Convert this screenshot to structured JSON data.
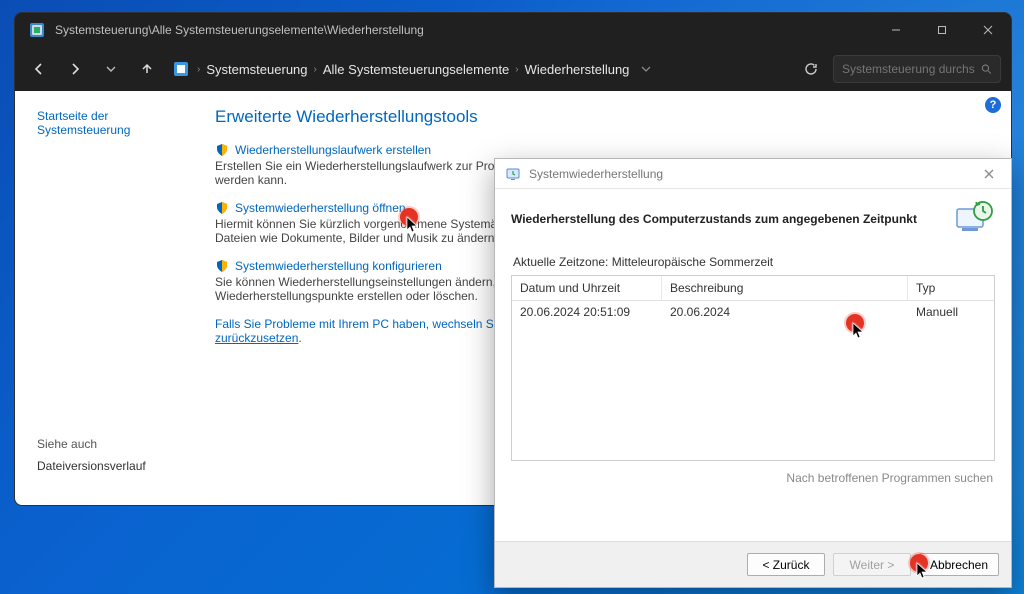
{
  "window": {
    "title": "Systemsteuerung\\Alle Systemsteuerungselemente\\Wiederherstellung"
  },
  "breadcrumb": {
    "root": "Systemsteuerung",
    "mid": "Alle Systemsteuerungselemente",
    "leaf": "Wiederherstellung"
  },
  "search": {
    "placeholder": "Systemsteuerung durchs…"
  },
  "sidebar": {
    "home": "Startseite der Systemsteuerung",
    "see_also_header": "Siehe auch",
    "file_history": "Dateiversionsverlauf"
  },
  "main": {
    "heading": "Erweiterte Wiederherstellungstools",
    "tool1_link": "Wiederherstellungslaufwerk erstellen",
    "tool1_desc": "Erstellen Sie ein Wiederherstellungslaufwerk zur Problembehandlung, wenn Ihr PC nicht gestartet werden kann.",
    "tool2_link": "Systemwiederherstellung öffnen",
    "tool2_desc": "Hiermit können Sie kürzlich vorgenommene Systemänderungen rückgängig machen, ohne jedoch Dateien wie Dokumente, Bilder und Musik zu ändern.",
    "tool3_link": "Systemwiederherstellung konfigurieren",
    "tool3_desc": "Sie können Wiederherstellungseinstellungen ändern, Speicherplatz verwalten und Wiederherstellungspunkte erstellen oder löschen.",
    "troubleshoot_a": "Falls Sie Probleme mit Ihrem PC haben, wechseln Sie zu \"Einstellungen\", und versuchen Sie, ihn",
    "troubleshoot_b": "zurückzusetzen",
    "troubleshoot_dot": "."
  },
  "dialog": {
    "title": "Systemwiederherstellung",
    "heading": "Wiederherstellung des Computerzustands zum angegebenen Zeitpunkt",
    "timezone_label": "Aktuelle Zeitzone: Mitteleuropäische Sommerzeit",
    "columns": {
      "dt": "Datum und Uhrzeit",
      "desc": "Beschreibung",
      "type": "Typ"
    },
    "rows": [
      {
        "dt": "20.06.2024 20:51:09",
        "desc": "20.06.2024",
        "type": "Manuell"
      }
    ],
    "scan": "Nach betroffenen Programmen suchen",
    "back": "< Zurück",
    "next": "Weiter >",
    "cancel": "Abbrechen"
  },
  "help_badge": "?"
}
